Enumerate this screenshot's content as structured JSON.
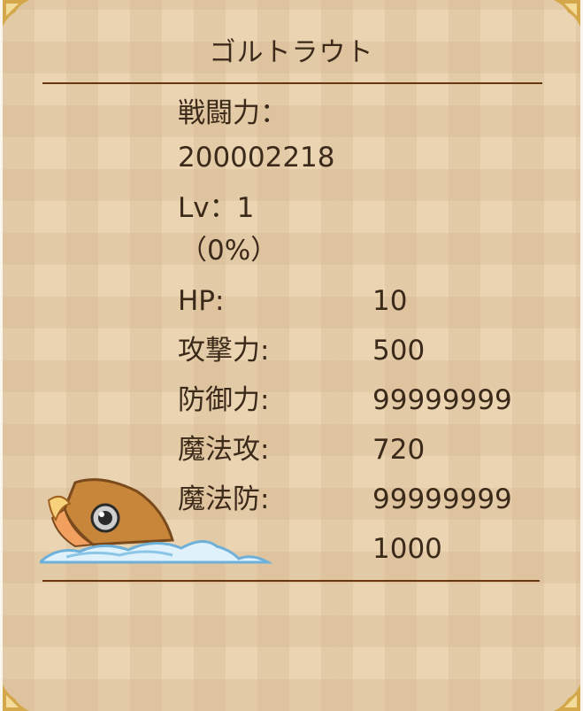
{
  "monster": {
    "name": "ゴルトラウト",
    "image_icon": "golden-trout-sprite"
  },
  "power": {
    "label": "戦闘力：",
    "value": "200002218"
  },
  "level": {
    "label": "Lv：1",
    "exp": "（0%）"
  },
  "stats": [
    {
      "label": "HP:",
      "value": "10"
    },
    {
      "label": "攻撃力:",
      "value": "500"
    },
    {
      "label": "防御力:",
      "value": "99999999"
    },
    {
      "label": "魔法攻:",
      "value": "720"
    },
    {
      "label": "魔法防:",
      "value": "99999999"
    },
    {
      "label": "",
      "value": "1000"
    }
  ],
  "colors": {
    "background": "#ead4b1",
    "rule": "#6b3510",
    "corner_gold": "#d4a84a"
  }
}
